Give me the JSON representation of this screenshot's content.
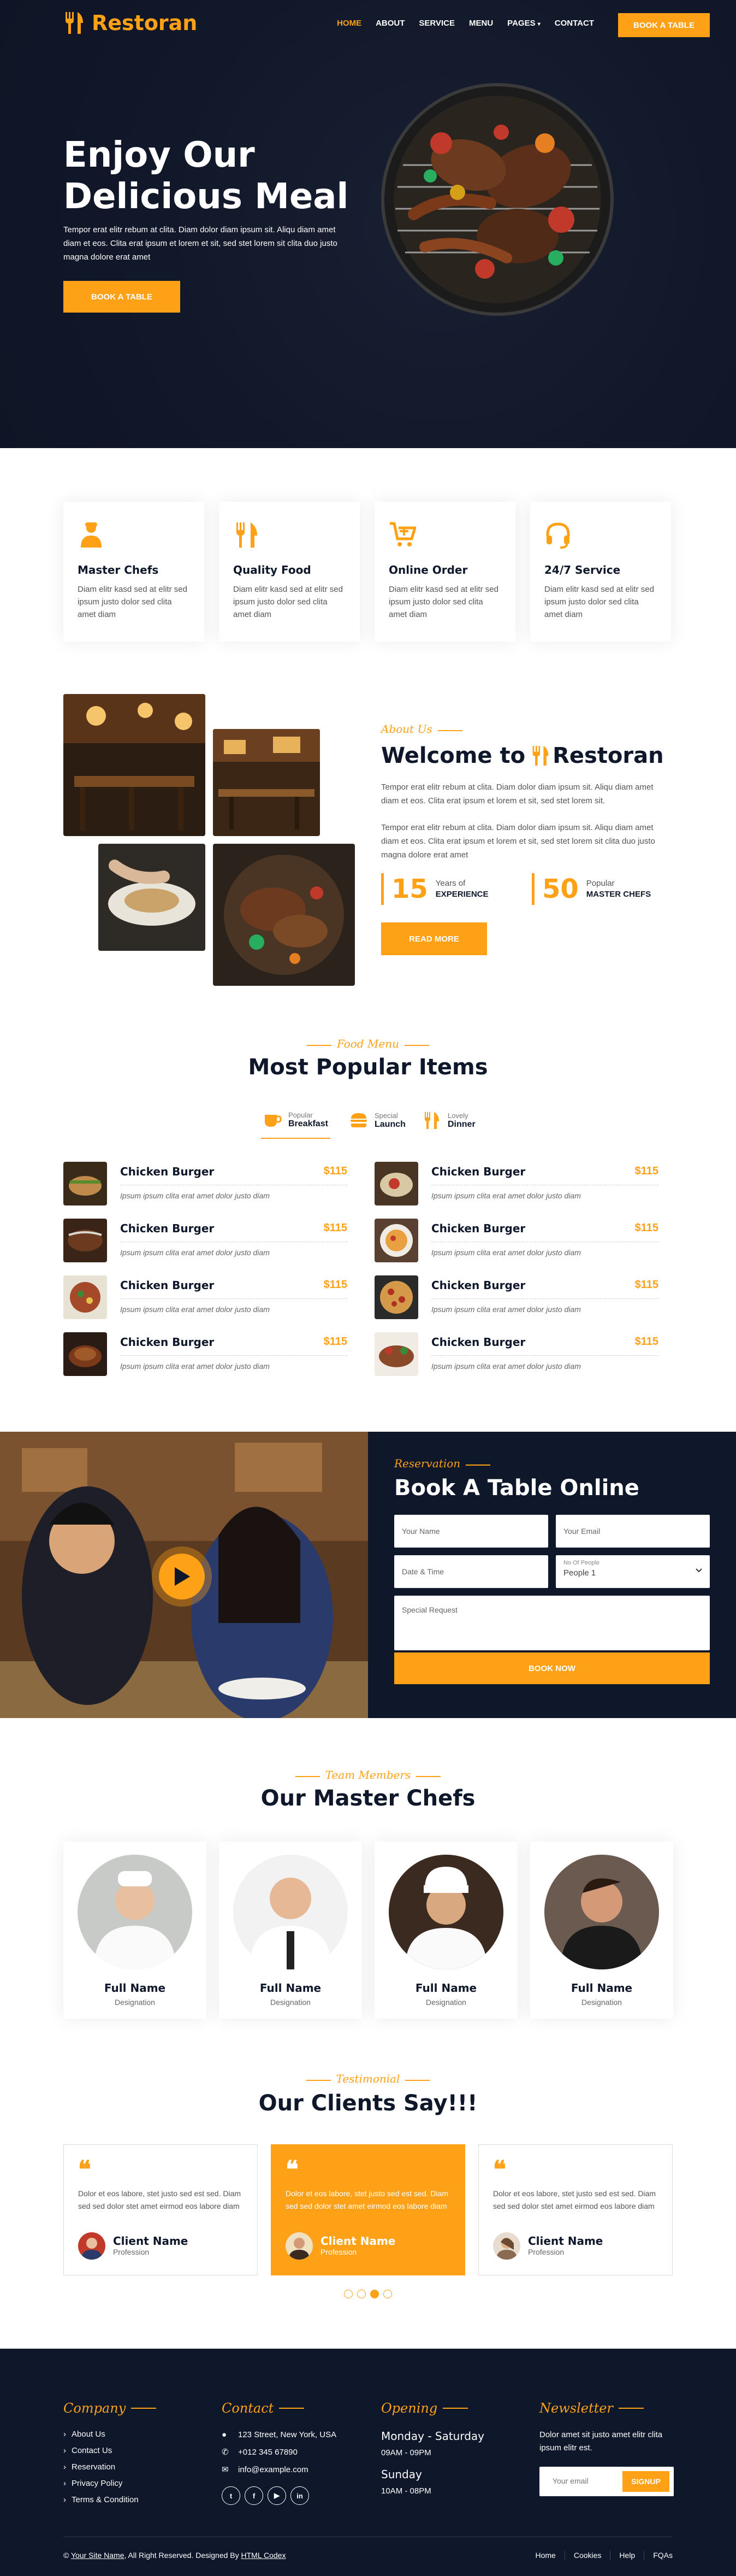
{
  "brand": {
    "name": "Restoran",
    "accent": "#FEA116",
    "dark": "#0F172B"
  },
  "nav": {
    "items": [
      "HOME",
      "ABOUT",
      "SERVICE",
      "MENU",
      "PAGES",
      "CONTACT"
    ],
    "pages_caret": "▾",
    "cta": "BOOK A TABLE"
  },
  "hero": {
    "title_line1": "Enjoy Our",
    "title_line2": "Delicious Meal",
    "text": "Tempor erat elitr rebum at clita. Diam dolor diam ipsum sit. Aliqu diam amet diam et eos. Clita erat ipsum et lorem et sit, sed stet lorem sit clita duo justo magna dolore erat amet",
    "button": "BOOK A TABLE"
  },
  "services": [
    {
      "icon": "chef-icon",
      "title": "Master Chefs",
      "text": "Diam elitr kasd sed at elitr sed ipsum justo dolor sed clita amet diam"
    },
    {
      "icon": "utensils-icon",
      "title": "Quality Food",
      "text": "Diam elitr kasd sed at elitr sed ipsum justo dolor sed clita amet diam"
    },
    {
      "icon": "cart-plus-icon",
      "title": "Online Order",
      "text": "Diam elitr kasd sed at elitr sed ipsum justo dolor sed clita amet diam"
    },
    {
      "icon": "headset-icon",
      "title": "24/7 Service",
      "text": "Diam elitr kasd sed at elitr sed ipsum justo dolor sed clita amet diam"
    }
  ],
  "about": {
    "subtitle": "About Us",
    "title_prefix": "Welcome to",
    "title_brand": "Restoran",
    "p1": "Tempor erat elitr rebum at clita. Diam dolor diam ipsum sit. Aliqu diam amet diam et eos. Clita erat ipsum et lorem et sit, sed stet lorem sit.",
    "p2": "Tempor erat elitr rebum at clita. Diam dolor diam ipsum sit. Aliqu diam amet diam et eos. Clita erat ipsum et lorem et sit, sed stet lorem sit clita duo justo magna dolore erat amet",
    "counters": [
      {
        "num": "15",
        "small": "Years of",
        "big": "EXPERIENCE"
      },
      {
        "num": "50",
        "small": "Popular",
        "big": "MASTER CHEFS"
      }
    ],
    "button": "READ MORE"
  },
  "menu": {
    "subtitle": "Food Menu",
    "title": "Most Popular Items",
    "tabs": [
      {
        "small": "Popular",
        "big": "Breakfast",
        "icon": "coffee-icon"
      },
      {
        "small": "Special",
        "big": "Launch",
        "icon": "hamburger-icon"
      },
      {
        "small": "Lovely",
        "big": "Dinner",
        "icon": "utensils-icon"
      }
    ],
    "items": [
      {
        "name": "Chicken Burger",
        "price": "$115",
        "desc": "Ipsum ipsum clita erat amet dolor justo diam"
      },
      {
        "name": "Chicken Burger",
        "price": "$115",
        "desc": "Ipsum ipsum clita erat amet dolor justo diam"
      },
      {
        "name": "Chicken Burger",
        "price": "$115",
        "desc": "Ipsum ipsum clita erat amet dolor justo diam"
      },
      {
        "name": "Chicken Burger",
        "price": "$115",
        "desc": "Ipsum ipsum clita erat amet dolor justo diam"
      },
      {
        "name": "Chicken Burger",
        "price": "$115",
        "desc": "Ipsum ipsum clita erat amet dolor justo diam"
      },
      {
        "name": "Chicken Burger",
        "price": "$115",
        "desc": "Ipsum ipsum clita erat amet dolor justo diam"
      },
      {
        "name": "Chicken Burger",
        "price": "$115",
        "desc": "Ipsum ipsum clita erat amet dolor justo diam"
      },
      {
        "name": "Chicken Burger",
        "price": "$115",
        "desc": "Ipsum ipsum clita erat amet dolor justo diam"
      }
    ]
  },
  "reservation": {
    "subtitle": "Reservation",
    "title": "Book A Table Online",
    "name_placeholder": "Your Name",
    "email_placeholder": "Your Email",
    "date_placeholder": "Date & Time",
    "people_label": "No Of People",
    "people_value": "People 1",
    "request_placeholder": "Special Request",
    "button": "BOOK NOW"
  },
  "team": {
    "subtitle": "Team Members",
    "title": "Our Master Chefs",
    "members": [
      {
        "name": "Full Name",
        "role": "Designation"
      },
      {
        "name": "Full Name",
        "role": "Designation"
      },
      {
        "name": "Full Name",
        "role": "Designation"
      },
      {
        "name": "Full Name",
        "role": "Designation"
      }
    ]
  },
  "testimonial": {
    "subtitle": "Testimonial",
    "title": "Our Clients Say!!!",
    "cards": [
      {
        "text": "Dolor et eos labore, stet justo sed est sed. Diam sed sed dolor stet amet eirmod eos labore diam",
        "name": "Client Name",
        "role": "Profession"
      },
      {
        "text": "Dolor et eos labore, stet justo sed est sed. Diam sed sed dolor stet amet eirmod eos labore diam",
        "name": "Client Name",
        "role": "Profession"
      },
      {
        "text": "Dolor et eos labore, stet justo sed est sed. Diam sed sed dolor stet amet eirmod eos labore diam",
        "name": "Client Name",
        "role": "Profession"
      }
    ]
  },
  "footer": {
    "company_title": "Company",
    "company_links": [
      "About Us",
      "Contact Us",
      "Reservation",
      "Privacy Policy",
      "Terms & Condition"
    ],
    "contact_title": "Contact",
    "address": "123 Street, New York, USA",
    "phone": "+012 345 67890",
    "email": "info@example.com",
    "social": [
      "t",
      "f",
      "▶",
      "in"
    ],
    "opening_title": "Opening",
    "days1": "Monday - Saturday",
    "hours1": "09AM - 09PM",
    "days2": "Sunday",
    "hours2": "10AM - 08PM",
    "newsletter_title": "Newsletter",
    "newsletter_text": "Dolor amet sit justo amet elitr clita ipsum elitr est.",
    "email_placeholder": "Your email",
    "signup": "SIGNUP",
    "copy_sym": "©",
    "copy_site": "Your Site Name",
    "copy_mid": ", All Right Reserved. Designed By ",
    "copy_designer": "HTML Codex",
    "bottom_links": [
      "Home",
      "Cookies",
      "Help",
      "FQAs"
    ]
  }
}
